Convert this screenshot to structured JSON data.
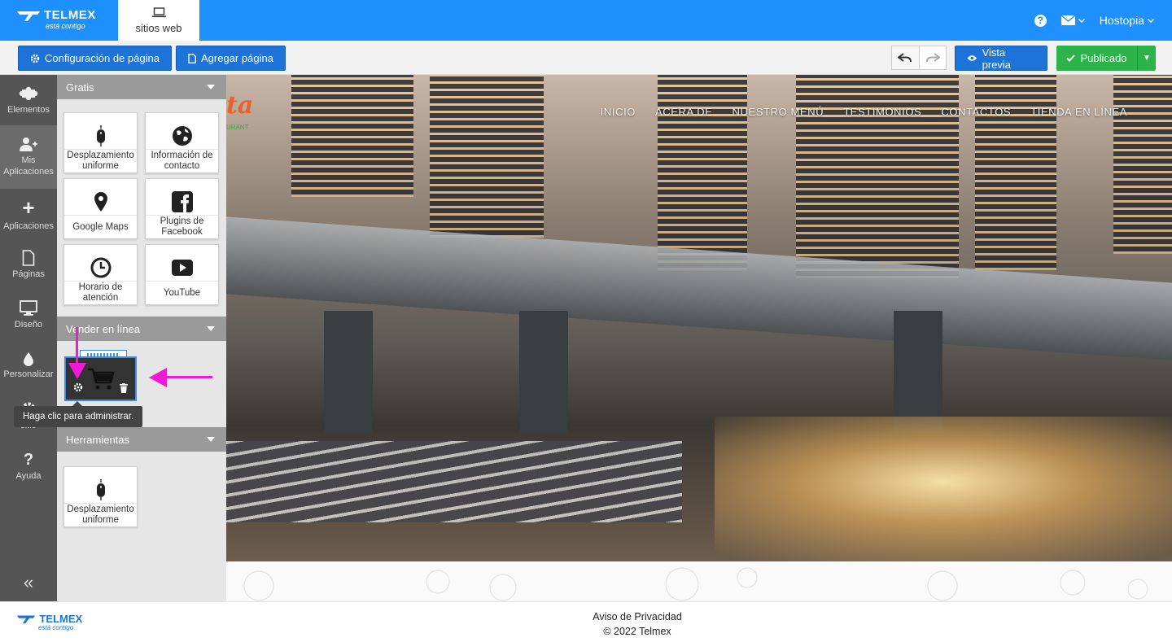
{
  "header": {
    "brand_name": "TELMEX",
    "brand_tagline": "está contigo",
    "site_tab_label": "sitios web",
    "help_icon_glyph": "?",
    "user_name": "Hostopia"
  },
  "toolbar": {
    "page_settings_label": "Configuración de página",
    "add_page_label": "Agregar página",
    "preview_label": "Vista previa",
    "published_label": "Publicado"
  },
  "leftnav": {
    "items": [
      {
        "label": "Elementos",
        "icon": "puzzle-icon",
        "glyph": "✚"
      },
      {
        "label": "Mis Aplicaciones",
        "icon": "user-plus-icon",
        "glyph": "👤"
      },
      {
        "label": "Aplicaciones",
        "icon": "plus-icon",
        "glyph": "+"
      },
      {
        "label": "Páginas",
        "icon": "page-icon",
        "glyph": "▯"
      },
      {
        "label": "Diseño",
        "icon": "monitor-icon",
        "glyph": "▭"
      },
      {
        "label": "Personalizar",
        "icon": "drop-icon",
        "glyph": "💧"
      },
      {
        "label": "sitio",
        "icon": "gear-icon",
        "glyph": "⚙"
      },
      {
        "label": "Ayuda",
        "icon": "question-icon",
        "glyph": "?"
      }
    ],
    "collapse_glyph": "«"
  },
  "panel": {
    "sections": {
      "free": "Gratis",
      "sell": "Vender en línea",
      "tools": "Herramientas"
    },
    "free_apps": [
      {
        "label": "Desplazamiento uniforme",
        "icon": "mouse-icon"
      },
      {
        "label": "Información de contacto",
        "icon": "globe-icon"
      },
      {
        "label": "Google Maps",
        "icon": "map-pin-icon"
      },
      {
        "label": "Plugins de Facebook",
        "icon": "facebook-icon"
      },
      {
        "label": "Horario de atención",
        "icon": "clock-icon"
      },
      {
        "label": "YouTube",
        "icon": "youtube-icon"
      }
    ],
    "tools_apps": [
      {
        "label": "Desplazamiento uniforme",
        "icon": "mouse-icon"
      }
    ],
    "tooltip": "Haga clic para administrar."
  },
  "site": {
    "logo_text": "ta",
    "logo_sub": "URANT",
    "nav": [
      "INICIO",
      "ACERA DE",
      "NUESTRO MENÚ",
      "TESTIMONIOS",
      "CONTACTOS",
      "TIENDA EN LÍNEA"
    ]
  },
  "footer": {
    "privacy": "Aviso de Privacidad",
    "copyright": "© 2022 Telmex"
  },
  "colors": {
    "topbar": "#1e90ff",
    "primary_button": "#1e73d8",
    "publish_button": "#2cb34a",
    "annotation_arrow": "#f01ad6"
  }
}
